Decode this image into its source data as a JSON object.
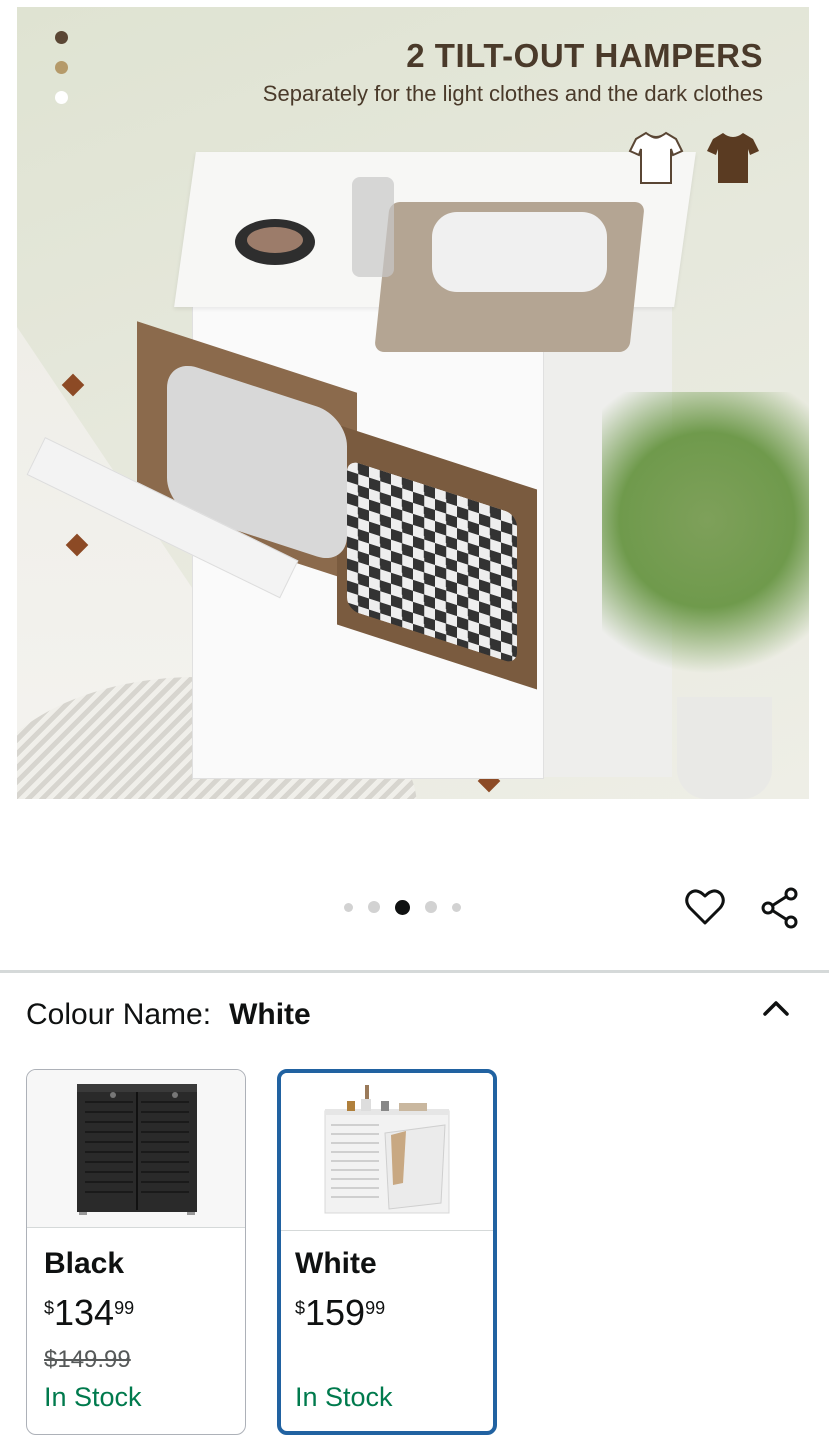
{
  "hero": {
    "title": "2 TILT-OUT HAMPERS",
    "subtitle": "Separately for the light clothes and the dark clothes",
    "dot_colors": [
      "#5a4634",
      "#b59a6a",
      "#ffffff"
    ],
    "icons": [
      "light-tshirt-icon",
      "dark-tshirt-icon"
    ]
  },
  "carousel": {
    "total": 5,
    "active_index": 2
  },
  "actions": {
    "favorite_icon": "heart-icon",
    "share_icon": "share-icon"
  },
  "colour": {
    "label": "Colour Name:",
    "selected": "White",
    "collapse_icon": "chevron-up-icon"
  },
  "options": [
    {
      "name": "Black",
      "price_symbol": "$",
      "price_whole": "134",
      "price_fraction": "99",
      "was_price": "$149.99",
      "stock": "In Stock",
      "selected": false
    },
    {
      "name": "White",
      "price_symbol": "$",
      "price_whole": "159",
      "price_fraction": "99",
      "was_price": "",
      "stock": "In Stock",
      "selected": true
    }
  ],
  "colors": {
    "selected_border": "#2162a1",
    "stock_green": "#007a4d",
    "hero_text": "#4a3a2a"
  }
}
